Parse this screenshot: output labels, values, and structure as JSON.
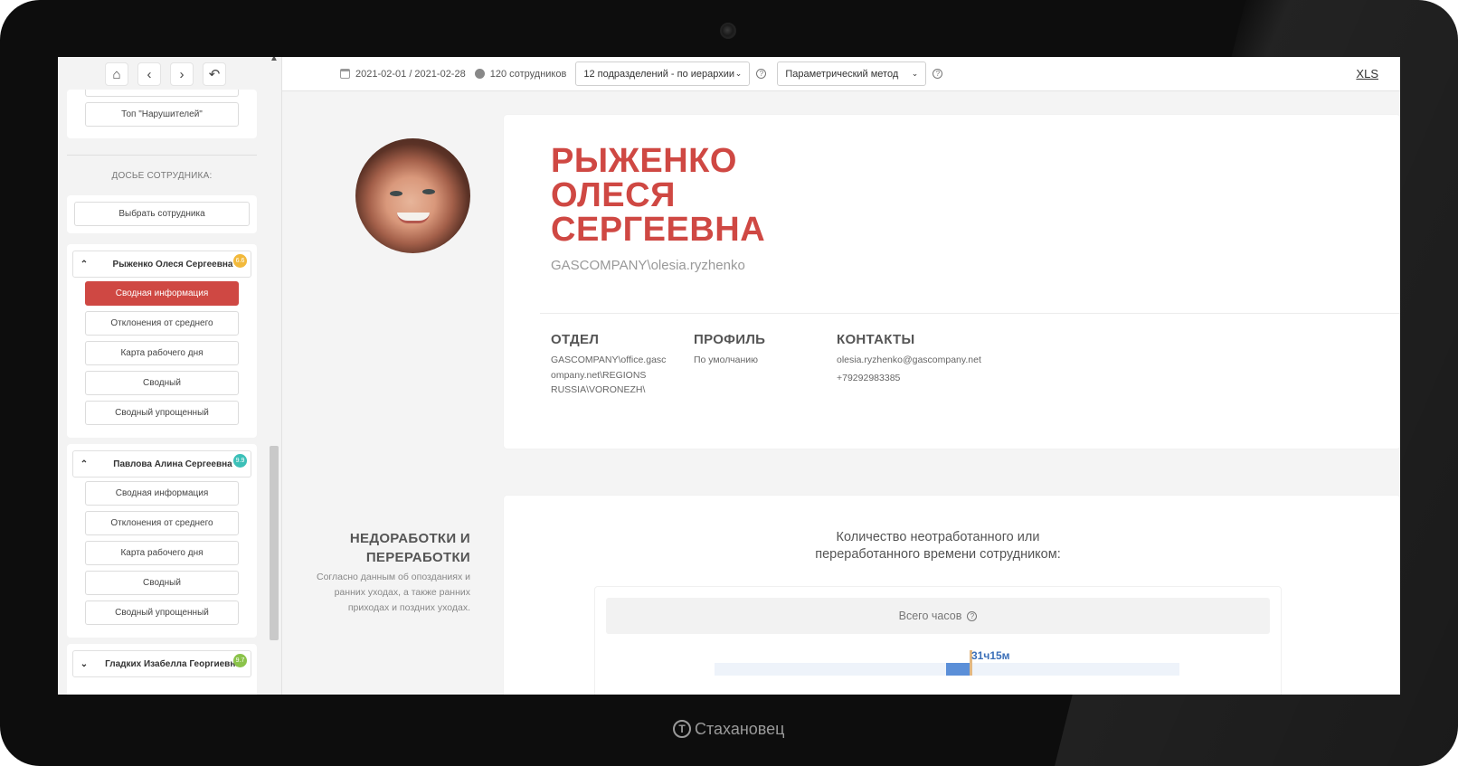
{
  "brand": {
    "name": "Стахановец",
    "mark": "T"
  },
  "sidebar": {
    "nav_icons": [
      "home-icon",
      "chevron-left-icon",
      "chevron-right-icon",
      "undo-icon"
    ],
    "top_button": "Топ \"Нарушителей\"",
    "dossier_label": "ДОСЬЕ СОТРУДНИКА:",
    "select_employee": "Выбрать сотрудника",
    "employees": [
      {
        "name": "Рыженко Олеся Сергеевна",
        "badge": "6.6",
        "badge_color": "#f2b93b",
        "expanded": true,
        "items": [
          "Сводная информация",
          "Отклонения от среднего",
          "Карта рабочего дня",
          "Сводный",
          "Сводный упрощенный"
        ],
        "active_item": "Сводная информация"
      },
      {
        "name": "Павлова Алина Сергеевна",
        "badge": "9.9",
        "badge_color": "#3cc0b8",
        "expanded": true,
        "items": [
          "Сводная информация",
          "Отклонения от среднего",
          "Карта рабочего дня",
          "Сводный",
          "Сводный упрощенный"
        ]
      },
      {
        "name": "Гладких Изабелла Георгиевна",
        "badge": "9.7",
        "badge_color": "#8bc34a",
        "expanded": false
      }
    ]
  },
  "topbar": {
    "date_range": "2021-02-01 / 2021-02-28",
    "employees_count": "120 сотрудников",
    "departments_select": "12 подразделений - по иерархии",
    "method_select": "Параметрический метод",
    "xls": "XLS"
  },
  "profile": {
    "name_line1": "РЫЖЕНКО",
    "name_line2": "ОЛЕСЯ",
    "name_line3": "СЕРГЕЕВНА",
    "login": "GASCOMPANY\\olesia.ryzhenko",
    "department_label": "ОТДЕЛ",
    "department_line1": "GASCOMPANY\\office.gasc",
    "department_line2": "ompany.net\\REGIONS",
    "department_line3": "RUSSIA\\VORONEZH\\",
    "profile_label": "ПРОФИЛЬ",
    "profile_value": "По умолчанию",
    "contacts_label": "КОНТАКТЫ",
    "email": "olesia.ryzhenko@gascompany.net",
    "phone": "+79292983385",
    "accent_color": "#cf4843"
  },
  "underwork": {
    "title_line1": "НЕДОРАБОТКИ И",
    "title_line2": "ПЕРЕРАБОТКИ",
    "desc_line1": "Согласно данным об опозданиях и",
    "desc_line2": "ранних уходах, а также ранних",
    "desc_line3": "приходах и поздних уходах.",
    "chart_title_line1": "Количество неотработанного или",
    "chart_title_line2": "переработанного времени сотрудником:",
    "total_hours_label": "Всего часов",
    "bar_value": "31ч15м"
  }
}
